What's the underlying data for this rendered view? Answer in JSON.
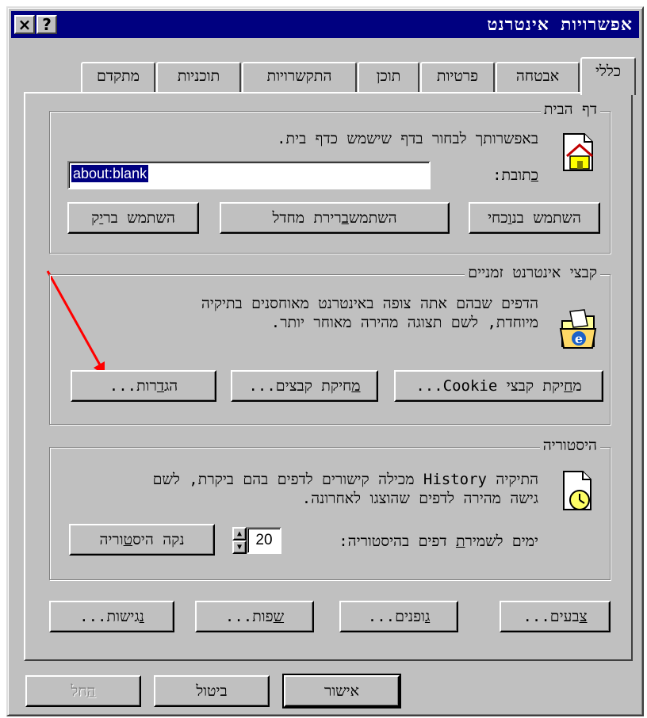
{
  "window": {
    "title": "אפשרויות אינטרנט",
    "close_glyph": "×",
    "help_glyph": "?"
  },
  "tabs": [
    {
      "label": "כללי",
      "active": true
    },
    {
      "label": "אבטחה"
    },
    {
      "label": "פרטיות"
    },
    {
      "label": "תוכן"
    },
    {
      "label": "התקשרויות"
    },
    {
      "label": "תוכניות"
    },
    {
      "label": "מתקדם"
    }
  ],
  "home_page": {
    "group_label": "דף הבית",
    "description": "באפשרותך לבחור בדף שישמש כדף בית.",
    "address_label_pre": "",
    "address_label_underlined": "כ",
    "address_label_post": "תובת:",
    "address_value": "about:blank",
    "btn_current_pre": "השתמש בנ",
    "btn_current_ul": "ו",
    "btn_current_post": "כחי",
    "btn_default_pre": "השתמש ",
    "btn_default_ul": "ב",
    "btn_default_post": "רירת מחדל",
    "btn_blank_pre": "השתמש בר",
    "btn_blank_ul": "י",
    "btn_blank_post": "ק"
  },
  "temp_files": {
    "group_label": "קבצי אינטרנט זמניים",
    "description_line1": "הדפים שבהם אתה צופה באינטרנט מאוחסנים בתיקיה",
    "description_line2": "מיוחדת, לשם תצוגה מהירה מאוחר יותר.",
    "btn_cookies_pre": "מ",
    "btn_cookies_ul": "ח",
    "btn_cookies_post": "יקת קבצי Cookie...",
    "btn_files_pre": "",
    "btn_files_ul": "מ",
    "btn_files_post": "חיקת קבצים...",
    "btn_settings_pre": "הג",
    "btn_settings_ul": "ד",
    "btn_settings_post": "רות..."
  },
  "history": {
    "group_label": "היסטוריה",
    "description_line1": "התיקיה History מכילה קישורים לדפים בהם ביקרת, לשם",
    "description_line2": "גישה מהירה לדפים שהוצגו לאחרונה.",
    "days_label_pre": "ימים לשמיר",
    "days_label_ul": "ת",
    "days_label_post": " דפים בהיסטוריה:",
    "days_value": "20",
    "btn_clear_pre": "נקה היס",
    "btn_clear_ul": "ט",
    "btn_clear_post": "וריה"
  },
  "bottom_row": {
    "colors_ul": "צ",
    "colors_post": "בעים...",
    "fonts_ul": "ג",
    "fonts_post": "ופנים...",
    "languages_ul": "ש",
    "languages_post": "פות...",
    "accessibility_ul": "נ",
    "accessibility_post": "גישות..."
  },
  "dialog": {
    "ok": "אישור",
    "cancel": "ביטול",
    "apply_ul": "ה",
    "apply_post": "חל"
  },
  "colors": {
    "titlebar": "#000080",
    "face": "#c0c0c0",
    "annotation_arrow": "#ff0000"
  }
}
